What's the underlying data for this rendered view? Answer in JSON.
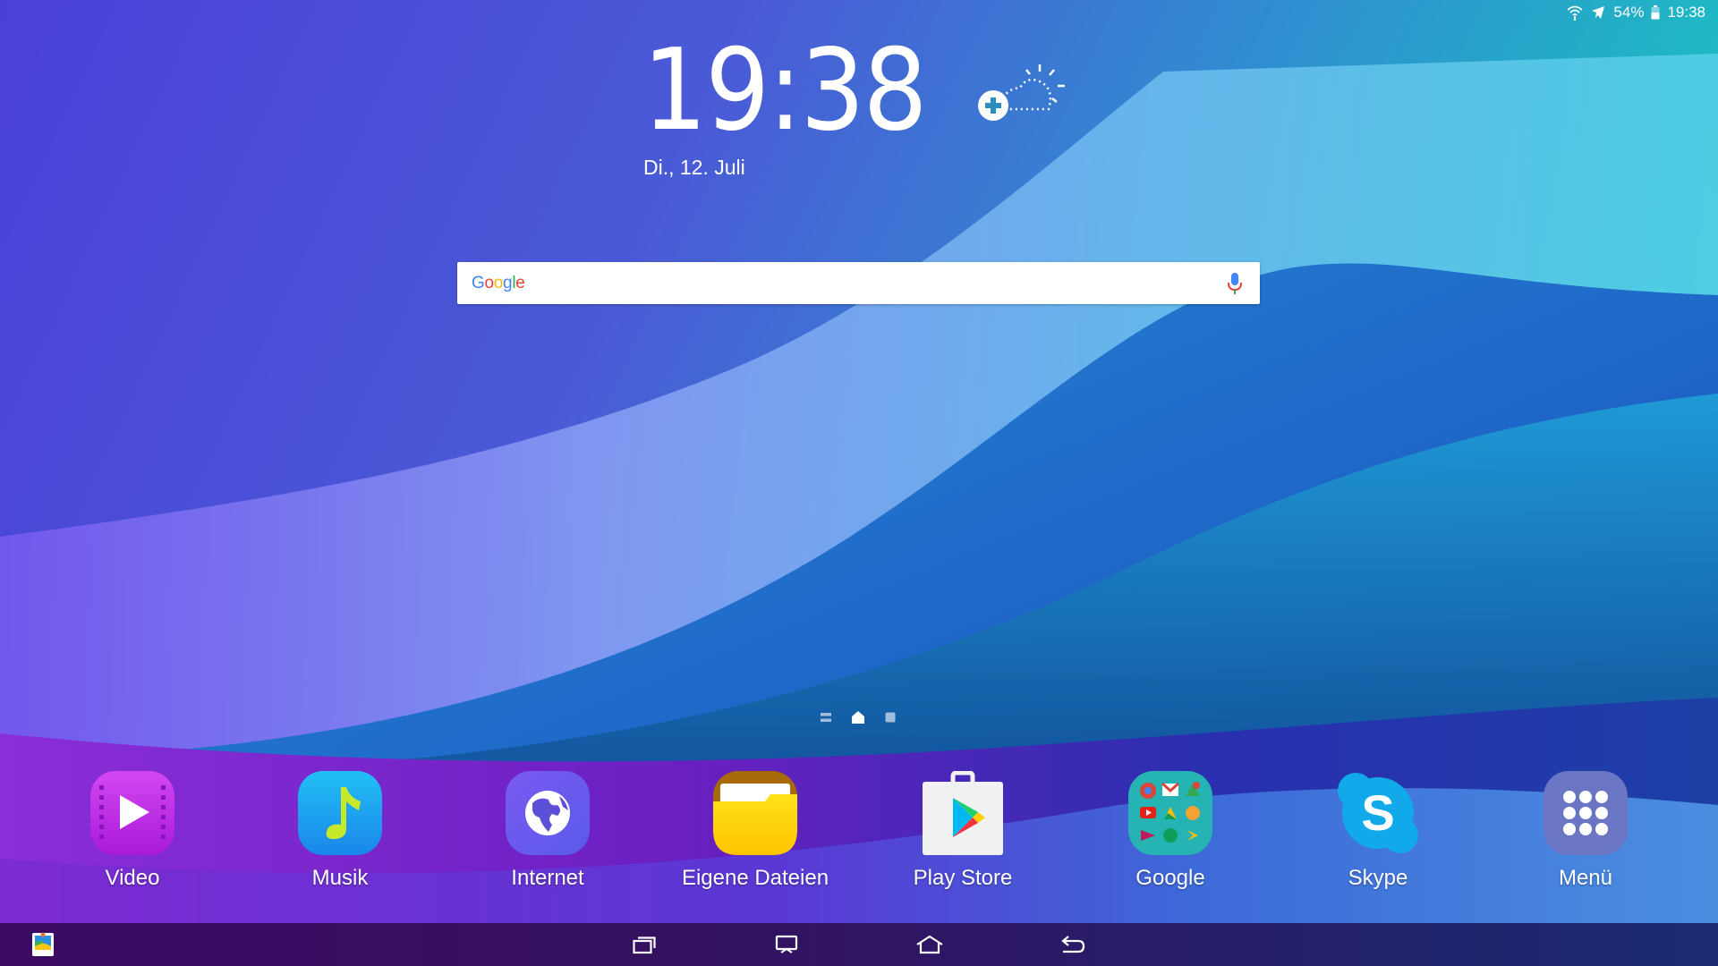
{
  "status_bar": {
    "wifi_icon": "wifi-icon",
    "airplane_icon": "airplane-mode-icon",
    "battery_percent": "54%",
    "battery_level": 0.54,
    "time": "19:38"
  },
  "clock_widget": {
    "time_hours": "19",
    "time_sep": ":",
    "time_minutes": "38",
    "date": "Di., 12. Juli",
    "weather_icon": "add-weather-icon"
  },
  "search_widget": {
    "logo_text": [
      "G",
      "o",
      "o",
      "g",
      "l",
      "e"
    ],
    "logo_colors": [
      "#4285f4",
      "#ea4335",
      "#fbbc05",
      "#4285f4",
      "#34a853",
      "#ea4335"
    ],
    "value": "",
    "placeholder": "",
    "mic_icon": "microphone-icon"
  },
  "page_indicator": {
    "pages": [
      "overview",
      "home",
      "page"
    ],
    "active": "home"
  },
  "dock": {
    "apps": [
      {
        "label": "Video",
        "icon": "video-icon"
      },
      {
        "label": "Musik",
        "icon": "music-icon"
      },
      {
        "label": "Internet",
        "icon": "internet-globe-icon"
      },
      {
        "label": "Eigene Dateien",
        "icon": "folder-icon"
      },
      {
        "label": "Play Store",
        "icon": "play-store-icon"
      },
      {
        "label": "Google",
        "icon": "google-folder-icon"
      },
      {
        "label": "Skype",
        "icon": "skype-icon"
      },
      {
        "label": "Menü",
        "icon": "apps-grid-icon"
      }
    ]
  },
  "nav_bar": {
    "left_icon": "gallery-icon",
    "buttons": [
      "recent-apps",
      "screen-mirroring",
      "home",
      "back"
    ]
  }
}
